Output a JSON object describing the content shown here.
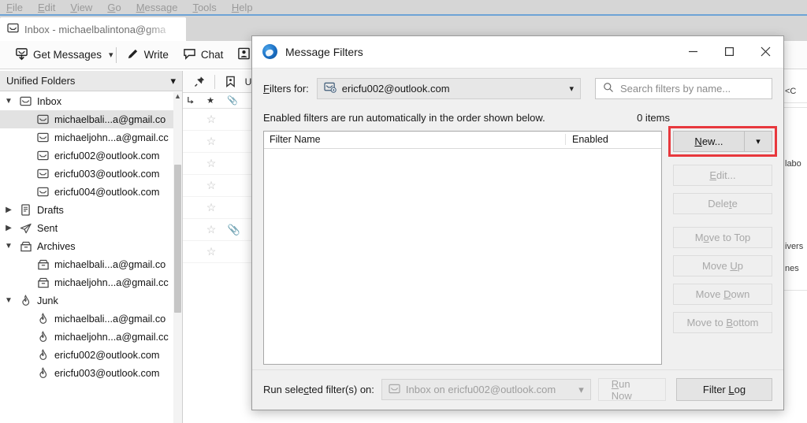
{
  "app": {
    "menubar": [
      "File",
      "Edit",
      "View",
      "Go",
      "Message",
      "Tools",
      "Help"
    ],
    "tab": {
      "label": "Inbox - michaelbalintona@gma",
      "icon": "inbox-envelope-icon"
    },
    "toolbar": {
      "get_messages": "Get Messages",
      "write": "Write",
      "chat": "Chat",
      "dropdown_caret": "⌄"
    },
    "sidebar": {
      "picker_label": "Unified Folders",
      "items": [
        {
          "label": "Inbox",
          "icon": "inbox-icon",
          "twisty": "expanded",
          "indent": 0,
          "selected": false
        },
        {
          "label": "michaelbali...a@gmail.co",
          "icon": "inbox-icon",
          "twisty": "none",
          "indent": 1,
          "selected": true
        },
        {
          "label": "michaeljohn...a@gmail.cc",
          "icon": "inbox-icon",
          "twisty": "none",
          "indent": 1,
          "selected": false
        },
        {
          "label": "ericfu002@outlook.com",
          "icon": "inbox-icon",
          "twisty": "none",
          "indent": 1,
          "selected": false
        },
        {
          "label": "ericfu003@outlook.com",
          "icon": "inbox-icon",
          "twisty": "none",
          "indent": 1,
          "selected": false
        },
        {
          "label": "ericfu004@outlook.com",
          "icon": "inbox-icon",
          "twisty": "none",
          "indent": 1,
          "selected": false
        },
        {
          "label": "Drafts",
          "icon": "drafts-icon",
          "twisty": "collapsed",
          "indent": 0,
          "selected": false
        },
        {
          "label": "Sent",
          "icon": "sent-icon",
          "twisty": "collapsed",
          "indent": 0,
          "selected": false
        },
        {
          "label": "Archives",
          "icon": "archive-icon",
          "twisty": "expanded",
          "indent": 0,
          "selected": false
        },
        {
          "label": "michaelbali...a@gmail.co",
          "icon": "archive-icon",
          "twisty": "none",
          "indent": 1,
          "selected": false
        },
        {
          "label": "michaeljohn...a@gmail.cc",
          "icon": "archive-icon",
          "twisty": "none",
          "indent": 1,
          "selected": false
        },
        {
          "label": "Junk",
          "icon": "junk-flame-icon",
          "twisty": "expanded",
          "indent": 0,
          "selected": false
        },
        {
          "label": "michaelbali...a@gmail.co",
          "icon": "junk-flame-icon",
          "twisty": "none",
          "indent": 1,
          "selected": false
        },
        {
          "label": "michaeljohn...a@gmail.cc",
          "icon": "junk-flame-icon",
          "twisty": "none",
          "indent": 1,
          "selected": false
        },
        {
          "label": "ericfu002@outlook.com",
          "icon": "junk-flame-icon",
          "twisty": "none",
          "indent": 1,
          "selected": false
        },
        {
          "label": "ericfu003@outlook.com",
          "icon": "junk-flame-icon",
          "twisty": "none",
          "indent": 1,
          "selected": false
        }
      ]
    },
    "messagelist": {
      "header_icons": [
        "thread-icon",
        "star-filled-icon",
        "attachment-icon"
      ],
      "rows": [
        {
          "star": "☆",
          "clip": ""
        },
        {
          "star": "☆",
          "clip": ""
        },
        {
          "star": "☆",
          "clip": ""
        },
        {
          "star": "☆",
          "clip": ""
        },
        {
          "star": "☆",
          "clip": ""
        },
        {
          "star": "☆",
          "clip": "📎"
        },
        {
          "star": "☆",
          "clip": ""
        }
      ]
    },
    "right_edge_text": [
      "<C",
      "labo",
      "ivers",
      "nes"
    ]
  },
  "dialog": {
    "title": "Message Filters",
    "logo_icon": "thunderbird-icon",
    "window_buttons": {
      "minimize": "minimize-icon",
      "maximize": "maximize-icon",
      "close": "close-icon"
    },
    "filters_for_label": "Filters for:",
    "filters_for_value": "ericfu002@outlook.com",
    "filters_for_icon": "account-envelope-icon",
    "search": {
      "placeholder": "Search filters by name...",
      "value": "",
      "icon": "search-icon"
    },
    "hint": "Enabled filters are run automatically in the order shown below.",
    "items_count": "0 items",
    "list": {
      "columns": [
        "Filter Name",
        "Enabled"
      ],
      "rows": []
    },
    "buttons": {
      "new": "New...",
      "new_caret": "⌄",
      "edit": "Edit...",
      "delete": "Delete",
      "move_to_top": "Move to Top",
      "move_up": "Move Up",
      "move_down": "Move Down",
      "move_to_bottom": "Move to Bottom"
    },
    "footer": {
      "run_label": "Run selected filter(s) on:",
      "target_value": "Inbox on ericfu002@outlook.com",
      "target_icon": "inbox-icon",
      "run_now": "Run Now",
      "filter_log": "Filter Log"
    },
    "highlight_color": "#e8383d"
  }
}
